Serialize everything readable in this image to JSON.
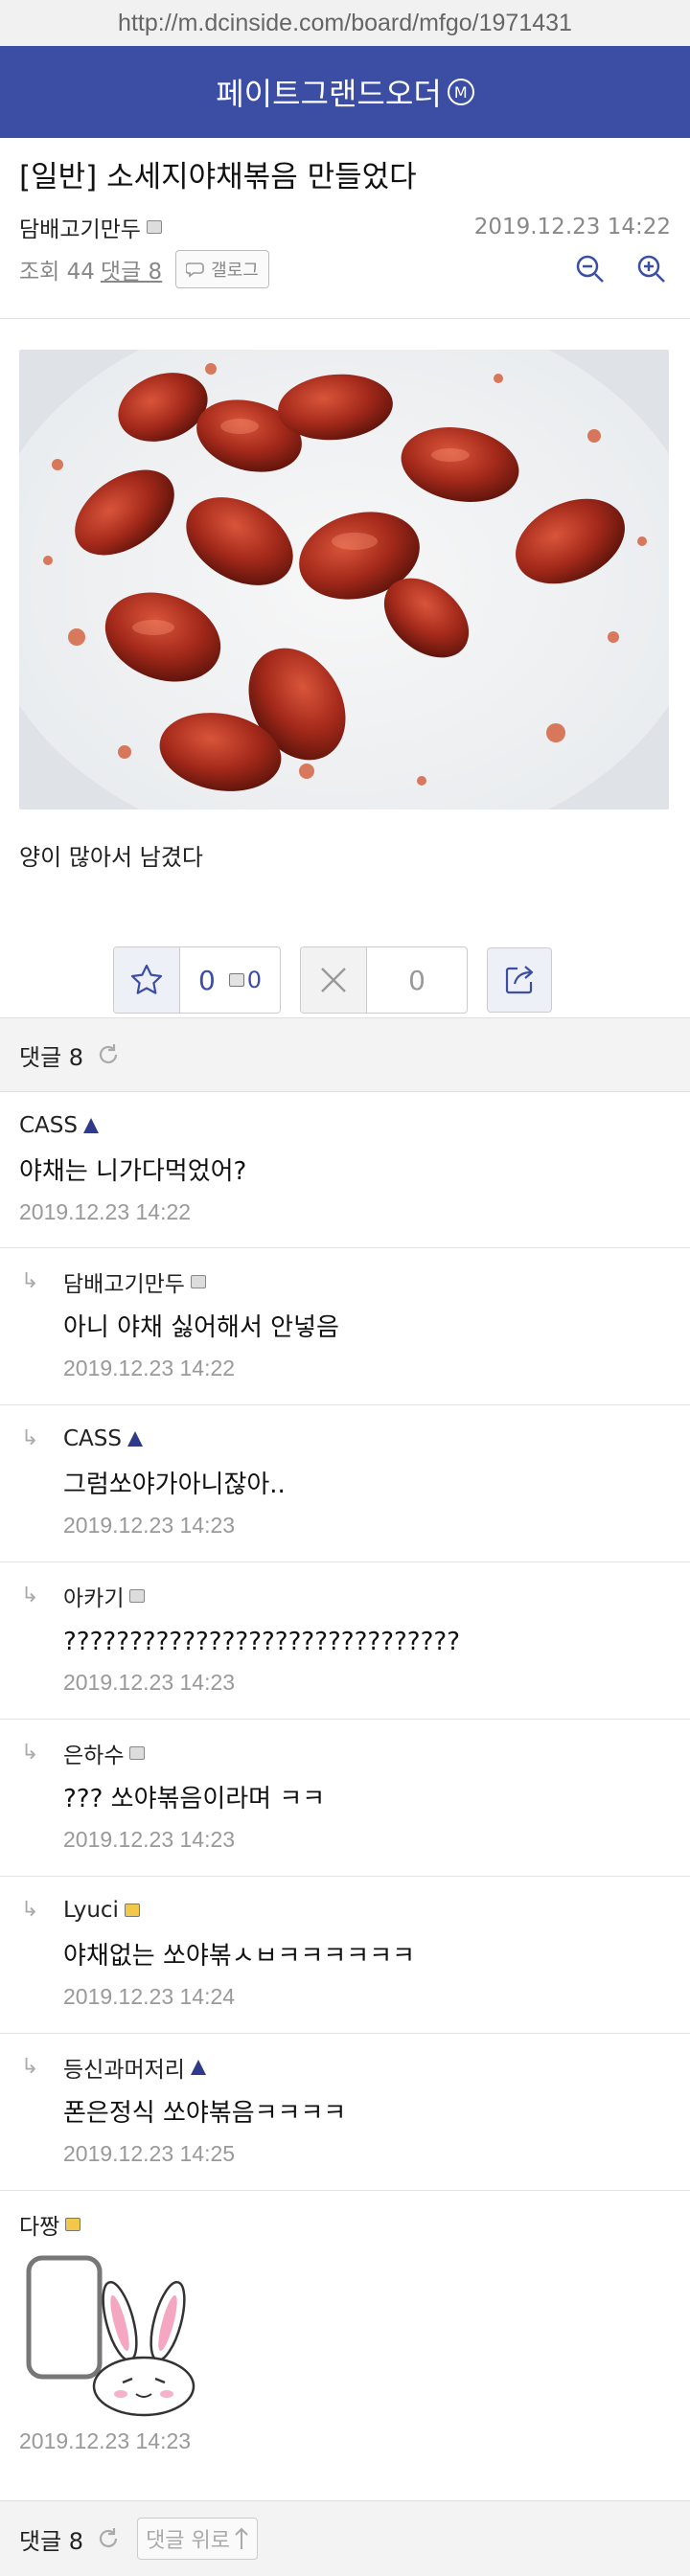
{
  "browser": {
    "url": "http://m.dcinside.com/board/mfgo/1971431"
  },
  "header": {
    "title": "페이트그랜드오더",
    "badge": "M"
  },
  "post": {
    "title": "[일반] 소세지야채볶음 만들었다",
    "author": "담배고기만두",
    "date": "2019.12.23 14:22",
    "views_label": "조회 44",
    "comments_label": "댓글 8",
    "gallog_label": "갤로그",
    "body": "양이 많아서 남겼다"
  },
  "actions": {
    "recommend_count": "0",
    "fix_recommend_count": "0",
    "not_recommend_count": "0"
  },
  "comment_bar": {
    "label": "댓글 8"
  },
  "comments": [
    {
      "nick": "CASS",
      "badge": "tree",
      "text": "야채는 니가다먹었어?",
      "time": "2019.12.23 14:22",
      "reply": false
    },
    {
      "nick": "담배고기만두",
      "badge": "grey",
      "text": "아니 야채 싫어해서 안넣음",
      "time": "2019.12.23 14:22",
      "reply": true
    },
    {
      "nick": "CASS",
      "badge": "tree",
      "text": "그럼쏘야가아니잖아..",
      "time": "2019.12.23 14:23",
      "reply": true
    },
    {
      "nick": "아카기",
      "badge": "grey",
      "text": "??????????????????????????????",
      "time": "2019.12.23 14:23",
      "reply": true
    },
    {
      "nick": "은하수",
      "badge": "grey",
      "text": "??? 쏘야볶음이라며 ㅋㅋ",
      "time": "2019.12.23 14:23",
      "reply": true
    },
    {
      "nick": "Lyuci",
      "badge": "gold",
      "text": "야채없는 쏘야볶ㅅㅂㅋㅋㅋㅋㅋㅋ",
      "time": "2019.12.23 14:24",
      "reply": true
    },
    {
      "nick": "등신과머저리",
      "badge": "tree",
      "text": "폰은정식 쏘야볶음ㅋㅋㅋㅋ",
      "time": "2019.12.23 14:25",
      "reply": true
    }
  ],
  "dccon_comment": {
    "nick": "다짱",
    "badge": "gold",
    "time": "2019.12.23 14:23"
  },
  "footer": {
    "label": "댓글 8",
    "top_button": "댓글 위로"
  },
  "colors": {
    "header_bg": "#3b4ea4",
    "accent": "#3b4ea4"
  }
}
